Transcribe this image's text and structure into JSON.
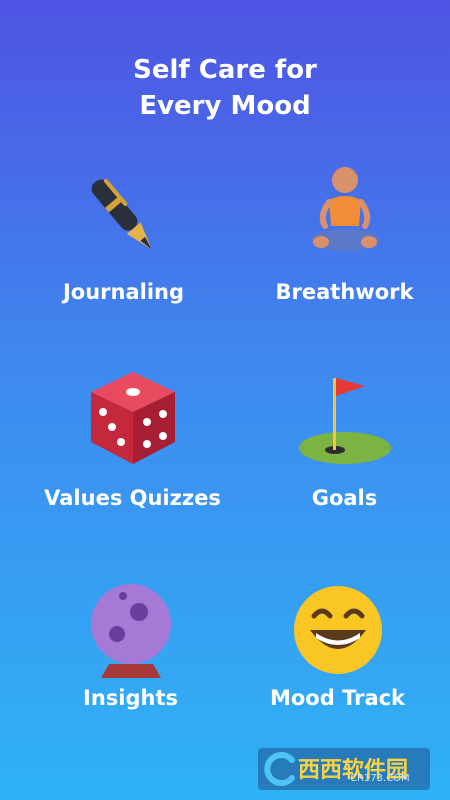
{
  "headline": {
    "line1": "Self Care for",
    "line2": "Every Mood"
  },
  "features": [
    {
      "label": "Journaling",
      "icon": "pen-icon"
    },
    {
      "label": "Breathwork",
      "icon": "meditating-person-icon"
    },
    {
      "label": "Values Quizzes",
      "icon": "dice-icon"
    },
    {
      "label": "Goals",
      "icon": "golf-flag-icon"
    },
    {
      "label": "Insights",
      "icon": "crystal-ball-icon"
    },
    {
      "label": "Mood Track",
      "icon": "grinning-face-icon"
    }
  ],
  "watermark": {
    "main": "西西软件园",
    "sub": "CR173.COM"
  },
  "colors": {
    "gradient_top": "#4f53e3",
    "gradient_bottom": "#2fb2f5",
    "text": "#ffffff"
  }
}
